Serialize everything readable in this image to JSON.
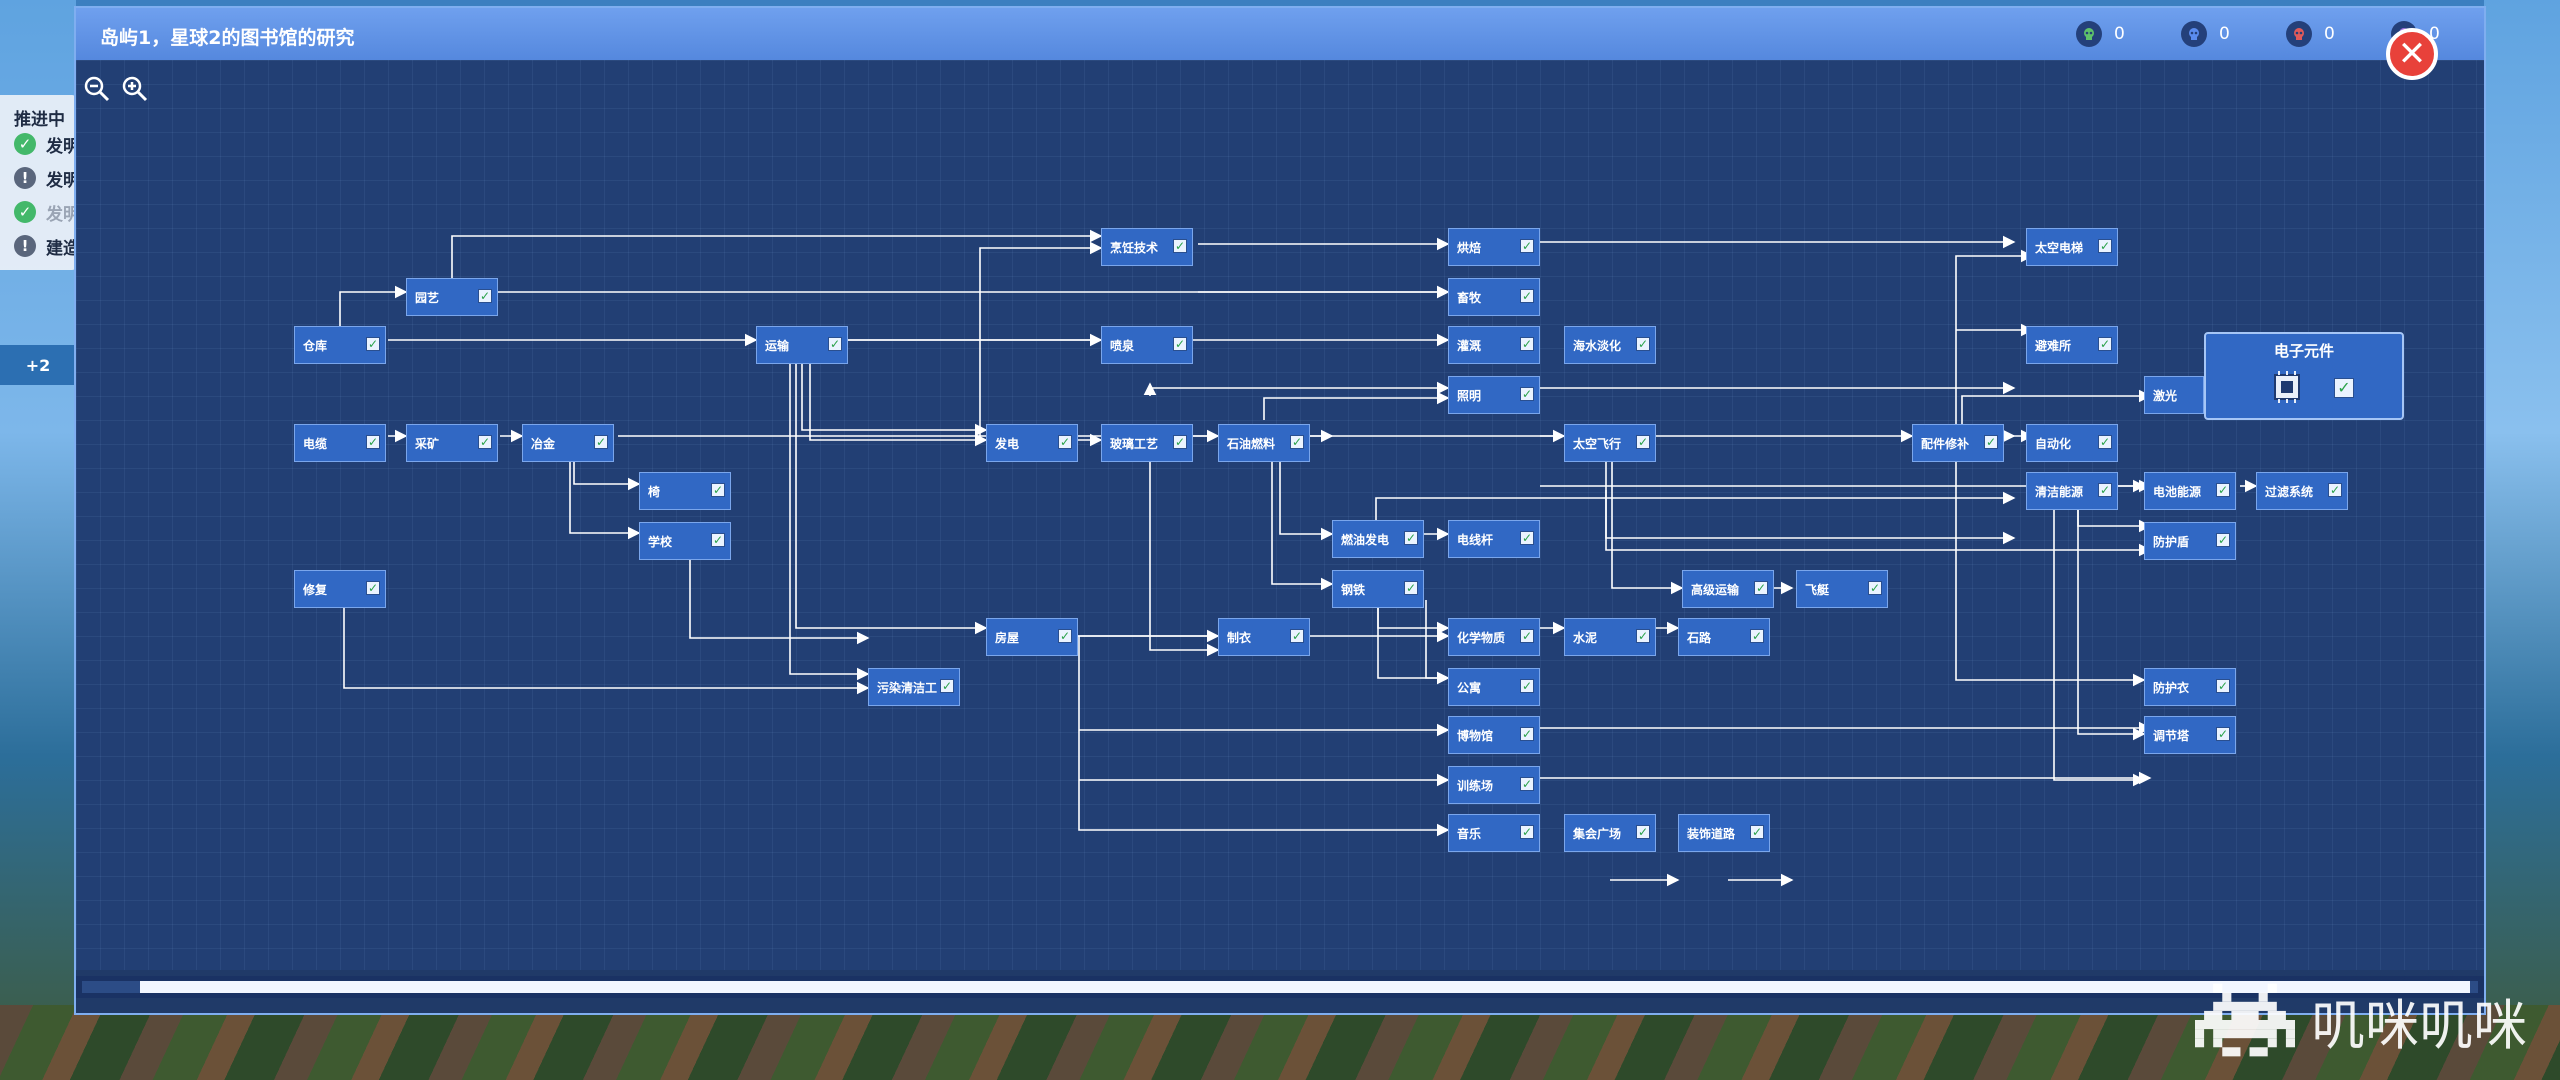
{
  "window": {
    "title": "岛屿1，星球2的图书馆的研究",
    "close_label": "✕"
  },
  "currencies": [
    {
      "icon": "green-skull-icon",
      "color": "#5ec26a",
      "value": "0"
    },
    {
      "icon": "blue-skull-icon",
      "color": "#5a8cf0",
      "value": "0"
    },
    {
      "icon": "red-skull-icon",
      "color": "#e05a5a",
      "value": "0"
    },
    {
      "icon": "purple-skull-icon",
      "color": "#a070e0",
      "value": "0"
    }
  ],
  "side_panel": {
    "title": "推进中",
    "objectives": [
      {
        "text": "发明",
        "state": "done"
      },
      {
        "text": "发明",
        "state": "alert"
      },
      {
        "text": "发明",
        "state": "done-dim"
      },
      {
        "text": "建造",
        "state": "alert"
      }
    ],
    "more_label": "+2"
  },
  "zoom": {
    "out_icon": "zoom-out-icon",
    "in_icon": "zoom-in-icon"
  },
  "nodes": {
    "yuanyi": "园艺",
    "cangku": "仓库",
    "dianlan": "电缆",
    "caikuang": "采矿",
    "yejin": "冶金",
    "yi": "椅",
    "xuexiao": "学校",
    "xiufu": "修复",
    "yunshu": "运输",
    "wuranqingli": "污染清洁工",
    "pengrenjishu": "烹饪技术",
    "penquan": "喷泉",
    "fadian": "发电",
    "fangwu": "房屋",
    "boligongyi": "玻璃工艺",
    "shiyouranliao": "石油燃料",
    "zhiyi": "制衣",
    "shaoyoufadian": "燃油发电",
    "gangtie": "钢铁",
    "hongbei": "烘焙",
    "xumu": "畜牧",
    "guangai": "灌溉",
    "zhaoming": "照明",
    "dianxiangan": "电线杆",
    "huaxuewuzhi": "化学物质",
    "gongyu": "公寓",
    "bowuguan": "博物馆",
    "xunlianchang": "训练场",
    "yinyue": "音乐",
    "haishuidanhua": "海水淡化",
    "taikongfeixing": "太空飞行",
    "shuini": "水泥",
    "jihuiguangchang": "集会广场",
    "gaojiyunshu": "高级运输",
    "shilu": "石路",
    "zhuangshidaolu": "装饰道路",
    "feiting": "飞艇",
    "taikongdianti": "太空电梯",
    "binansuo": "避难所",
    "peijianxiubu": "配件修补",
    "jiguang": "激光",
    "zidonghua": "自动化",
    "qingjienengyuan": "清洁能源",
    "dianchinengyuan": "电池能源",
    "guolvxitong": "过滤系统",
    "fanghudun": "防护盾",
    "fanghuyi": "防护衣",
    "diaojieta": "调节塔"
  },
  "highlight_node": {
    "title": "电子元件",
    "icon": "chip-icon"
  },
  "watermark": {
    "text": "叽咪叽咪",
    "icon": "space-invader-logo-icon"
  }
}
